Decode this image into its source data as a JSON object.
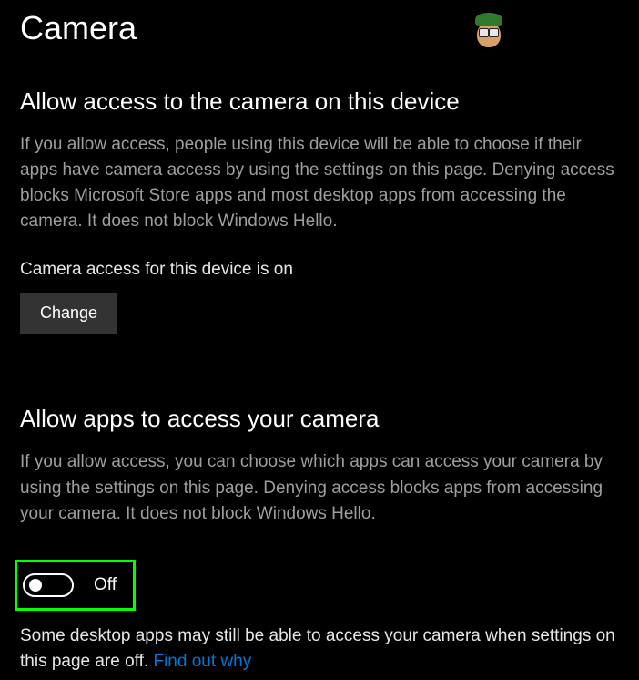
{
  "page": {
    "title": "Camera"
  },
  "section_device": {
    "heading": "Allow access to the camera on this device",
    "description": "If you allow access, people using this device will be able to choose if their apps have camera access by using the settings on this page. Denying access blocks Microsoft Store apps and most desktop apps from accessing the camera. It does not block Windows Hello.",
    "status": "Camera access for this device is on",
    "change_button": "Change"
  },
  "section_apps": {
    "heading": "Allow apps to access your camera",
    "description": "If you allow access, you can choose which apps can access your camera by using the settings on this page. Denying access blocks apps from accessing your camera. It does not block Windows Hello.",
    "toggle_state": "Off",
    "note_prefix": "Some desktop apps may still be able to access your camera when settings on this page are off. ",
    "note_link": "Find out why"
  }
}
